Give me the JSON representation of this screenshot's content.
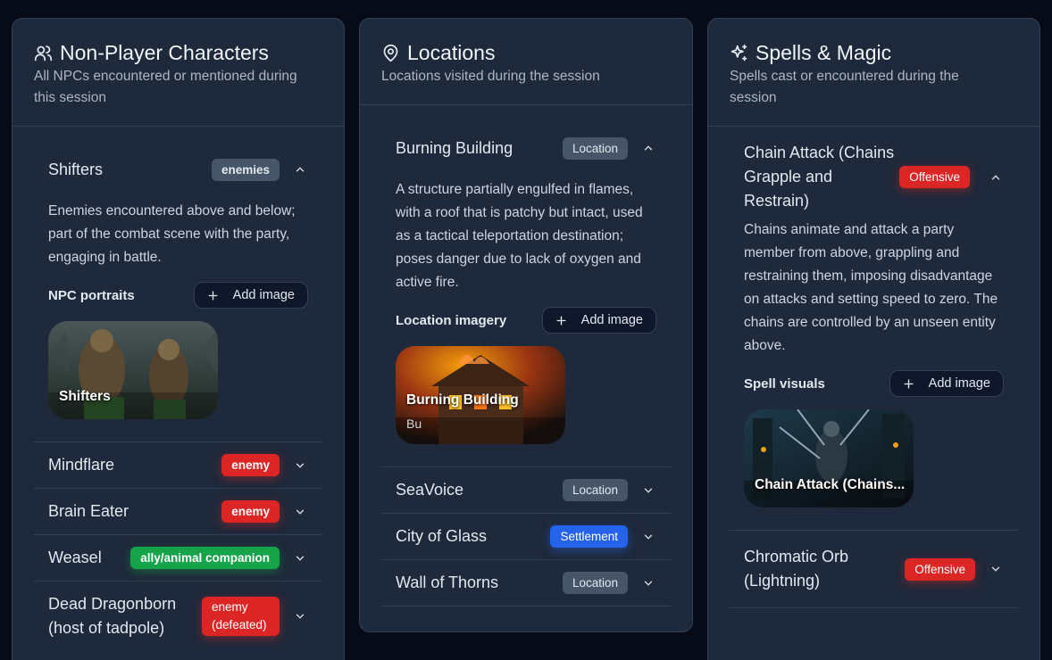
{
  "npcs": {
    "title": "Non-Player Characters",
    "subtitle": "All NPCs encountered or mentioned during this session",
    "expanded": {
      "name": "Shifters",
      "badge": "enemies",
      "description": "Enemies encountered above and below; part of the combat scene with the party, engaging in battle.",
      "images_label": "NPC portraits",
      "add_image": "Add image",
      "image_caption": "Shifters"
    },
    "items": [
      {
        "name": "Mindflare",
        "badge": "enemy"
      },
      {
        "name": "Brain Eater",
        "badge": "enemy"
      },
      {
        "name": "Weasel",
        "badge": "ally/animal companion"
      },
      {
        "name": "Dead Dragonborn (host of tadpole)",
        "badge": "enemy (defeated)"
      }
    ]
  },
  "locations": {
    "title": "Locations",
    "subtitle": "Locations visited during the session",
    "expanded": {
      "name": "Burning Building",
      "badge": "Location",
      "description": "A structure partially engulfed in flames, with a roof that is patchy but intact, used as a tactical teleportation destination; poses danger due to lack of oxygen and active fire.",
      "images_label": "Location imagery",
      "add_image": "Add image",
      "image_caption": "Burning Building",
      "image_subcaption": "Bu"
    },
    "items": [
      {
        "name": "SeaVoice",
        "badge": "Location"
      },
      {
        "name": "City of Glass",
        "badge": "Settlement"
      },
      {
        "name": "Wall of Thorns",
        "badge": "Location"
      }
    ]
  },
  "spells": {
    "title": "Spells & Magic",
    "subtitle": "Spells cast or encountered during the session",
    "expanded": {
      "name": "Chain Attack (Chains Grapple and Restrain)",
      "badge": "Offensive",
      "description": "Chains animate and attack a party member from above, grappling and restraining them, imposing disadvantage on attacks and setting speed to zero. The chains are controlled by an unseen entity above.",
      "images_label": "Spell visuals",
      "add_image": "Add image",
      "image_caption": "Chain Attack (Chains..."
    },
    "items": [
      {
        "name": "Chromatic Orb (Lightning)",
        "badge": "Offensive"
      }
    ]
  },
  "colors": {
    "background": "#070b18",
    "panel": "#1e293b",
    "enemy": "#dc2626",
    "ally": "#16a34a",
    "settlement": "#2563eb",
    "neutral": "#475569"
  }
}
